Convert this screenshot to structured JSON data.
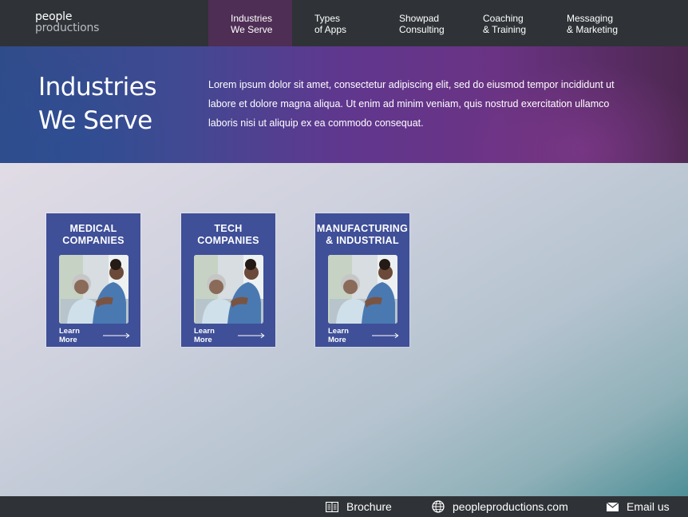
{
  "brand": {
    "line1": "people",
    "line2": "productions"
  },
  "nav": [
    {
      "line1": "Industries",
      "line2": "We Serve",
      "active": true
    },
    {
      "line1": "Types",
      "line2": "of Apps",
      "active": false
    },
    {
      "line1": "Showpad",
      "line2": "Consulting",
      "active": false
    },
    {
      "line1": "Coaching",
      "line2": "& Training",
      "active": false
    },
    {
      "line1": "Messaging",
      "line2": "& Marketing",
      "active": false
    }
  ],
  "hero": {
    "title_line1": "Industries",
    "title_line2": "We Serve",
    "text": "Lorem ipsum dolor sit amet, consectetur adipiscing elit, sed do eiusmod tempor incididunt ut labore et dolore magna aliqua. Ut enim ad minim veniam, quis nostrud exercitation ullamco laboris nisi ut aliquip ex ea commodo consequat."
  },
  "cards": [
    {
      "title_line1": "MEDICAL",
      "title_line2": "COMPANIES",
      "link": "Learn More"
    },
    {
      "title_line1": "TECH",
      "title_line2": "COMPANIES",
      "link": "Learn More"
    },
    {
      "title_line1": "MANUFACTURING",
      "title_line2": "& INDUSTRIAL",
      "link": "Learn More"
    }
  ],
  "footer": {
    "brochure": "Brochure",
    "website": "peopleproductions.com",
    "email": "Email us"
  },
  "colors": {
    "nav_bg": "#2f3337",
    "nav_active": "#4e2e55",
    "card_bg": "#3f4f98"
  }
}
